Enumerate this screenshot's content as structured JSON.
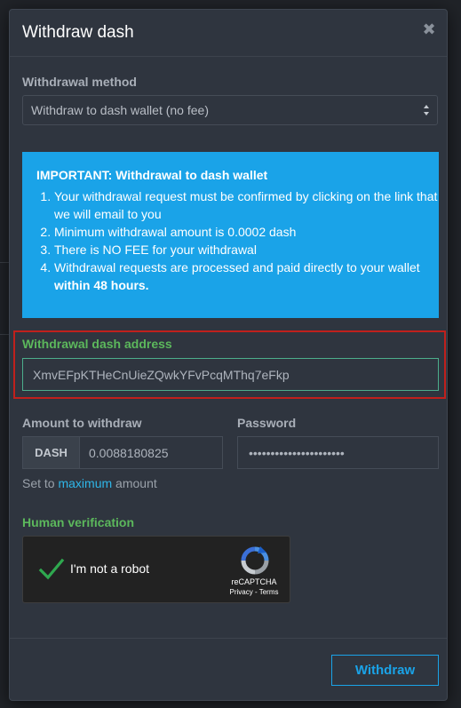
{
  "modal": {
    "title": "Withdraw dash",
    "close_icon": "close-icon"
  },
  "withdrawal_method": {
    "label": "Withdrawal method",
    "selected": "Withdraw to dash wallet (no fee)"
  },
  "notice": {
    "title": "IMPORTANT: Withdrawal to dash wallet",
    "items": [
      "Your withdrawal request must be confirmed by clicking on the link that we will email to you",
      "Minimum withdrawal amount is 0.0002 dash",
      "There is NO FEE for your withdrawal",
      "Withdrawal requests are processed and paid directly to your wallet"
    ],
    "item4_emphasis": "within 48 hours.",
    "color": "#1aa3e8"
  },
  "address": {
    "label": "Withdrawal dash address",
    "value": "XmvEFpKTHeCnUieZQwkYFvPcqMThq7eFkp"
  },
  "amount": {
    "label": "Amount to withdraw",
    "currency": "DASH",
    "value": "0.0088180825"
  },
  "password": {
    "label": "Password",
    "value": "••••••••••••••••••••••"
  },
  "set_max": {
    "prefix": "Set to",
    "link": "maximum",
    "suffix": "amount"
  },
  "verification": {
    "label": "Human verification",
    "checkbox_label": "I'm not a robot",
    "brand": "reCAPTCHA",
    "links": "Privacy - Terms"
  },
  "footer": {
    "withdraw_label": "Withdraw"
  },
  "colors": {
    "accent": "#1aa3e8",
    "success": "#5cb85c",
    "highlight": "#c0201c"
  }
}
